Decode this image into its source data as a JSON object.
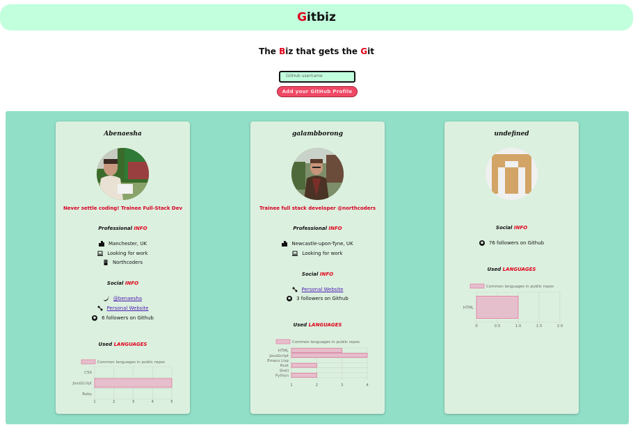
{
  "header": {
    "brand_first": "G",
    "brand_rest": "itbiz"
  },
  "tagline": {
    "t1": "The ",
    "t2": "B",
    "t3": "iz that gets the ",
    "t4": "G",
    "t5": "it"
  },
  "search": {
    "placeholder": "GitHub username"
  },
  "add_button": {
    "label": "Add your GitHub Profile"
  },
  "sections": {
    "professional": "Professional",
    "social": "Social",
    "used": "Used",
    "info": "INFO",
    "languages": "LANGUAGES"
  },
  "colors": {
    "accent": "#e0001b",
    "header_bg": "#c1ffdd",
    "panel_bg": "#91dfc6",
    "card_bg": "#dcf0df",
    "bar_fill": "#e6bfcd",
    "bar_border": "#e2779d"
  },
  "cards": [
    {
      "name": "Abenaesha",
      "bio": "Never settle coding! Trainee Full-Stack Dev",
      "location": "Manchester, UK",
      "hireable": "Looking for work",
      "company": "Northcoders",
      "twitter": "@benaesha",
      "website": "Personal Website",
      "followers": "6 followers on Github"
    },
    {
      "name": "galambborong",
      "bio": "Trainee full stack developer @northcoders",
      "location": "Newcastle-upon-Tyne, UK",
      "hireable": "Looking for work",
      "website": "Personal Website",
      "followers": "3 followers on Github"
    },
    {
      "name": "undefined",
      "followers": "76 followers on Github"
    }
  ],
  "chart_data": [
    {
      "type": "bar",
      "orientation": "horizontal",
      "legend": "Common languages in public repos",
      "categories": [
        "CSS",
        "JavaScript",
        "Ruby"
      ],
      "values": [
        0,
        5,
        0
      ],
      "xlim": [
        1,
        5
      ],
      "xticks": [
        "1",
        "2",
        "3",
        "4",
        "5"
      ]
    },
    {
      "type": "bar",
      "orientation": "horizontal",
      "legend": "Common languages in public repos",
      "categories": [
        "HTML",
        "JavaScript",
        "Emacs Lisp",
        "Rust",
        "Shell",
        "Python"
      ],
      "values": [
        3,
        4,
        0,
        2,
        0,
        2
      ],
      "xlim": [
        1,
        4
      ],
      "xticks": [
        "1",
        "2",
        "3",
        "4"
      ]
    },
    {
      "type": "bar",
      "orientation": "horizontal",
      "legend": "Common languages in public repos",
      "categories": [
        "HTML"
      ],
      "values": [
        1
      ],
      "xlim": [
        0,
        2
      ],
      "xticks": [
        "0",
        "0.5",
        "1.0",
        "1.5",
        "2.0"
      ]
    }
  ]
}
